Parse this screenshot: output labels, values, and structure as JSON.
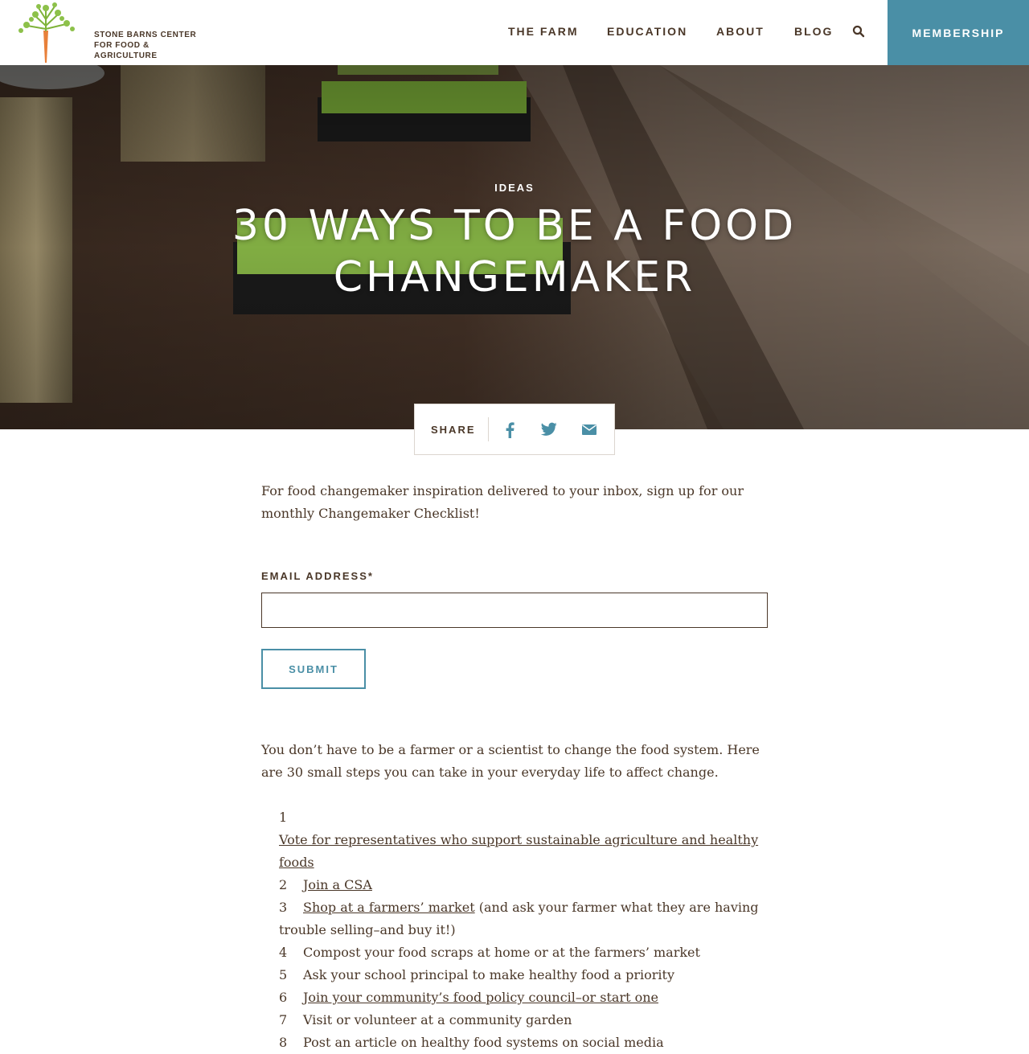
{
  "header": {
    "logo_line1": "STONE BARNS CENTER",
    "logo_line2": "FOR FOOD & AGRICULTURE",
    "nav": [
      "THE FARM",
      "EDUCATION",
      "ABOUT",
      "BLOG"
    ],
    "search_icon": "search-icon",
    "membership_label": "MEMBERSHIP"
  },
  "hero": {
    "category": "IDEAS",
    "title_line1": "30 WAYS TO BE A FOOD",
    "title_line2": "CHANGEMAKER"
  },
  "share": {
    "label": "SHARE",
    "icons": [
      "facebook-icon",
      "twitter-icon",
      "email-icon"
    ]
  },
  "signup": {
    "intro": "For food changemaker inspiration delivered to your inbox, sign up for our monthly Changemaker Checklist!",
    "email_label": "EMAIL ADDRESS*",
    "email_value": "",
    "submit_label": "SUBMIT"
  },
  "article": {
    "intro": "You don’t have to be a farmer or a scientist to change the food system. Here are 30 small steps you can take in your everyday life to affect change.",
    "steps": [
      {
        "num": "1",
        "link": "Vote for representatives who support sustainable agriculture and healthy foods",
        "text": ""
      },
      {
        "num": "2",
        "link": "Join a CSA",
        "text": ""
      },
      {
        "num": "3",
        "link": "Shop at a farmers’ market",
        "text": " (and ask your farmer what they are having trouble selling–and buy it!)"
      },
      {
        "num": "4",
        "link": "",
        "text": "Compost your food scraps at home or at the farmers’ market"
      },
      {
        "num": "5",
        "link": "",
        "text": "Ask your school principal to make healthy food a priority"
      },
      {
        "num": "6",
        "link": "Join your community’s food policy council–or start one",
        "text": ""
      },
      {
        "num": "7",
        "link": "",
        "text": "Visit or volunteer at a community garden"
      },
      {
        "num": "8",
        "link": "",
        "text": "Post an article on healthy food systems on social media"
      }
    ]
  },
  "colors": {
    "accent": "#4a8fa6",
    "text": "#4a3728",
    "carrot": "#e8803a",
    "leaf": "#7fb33a"
  }
}
